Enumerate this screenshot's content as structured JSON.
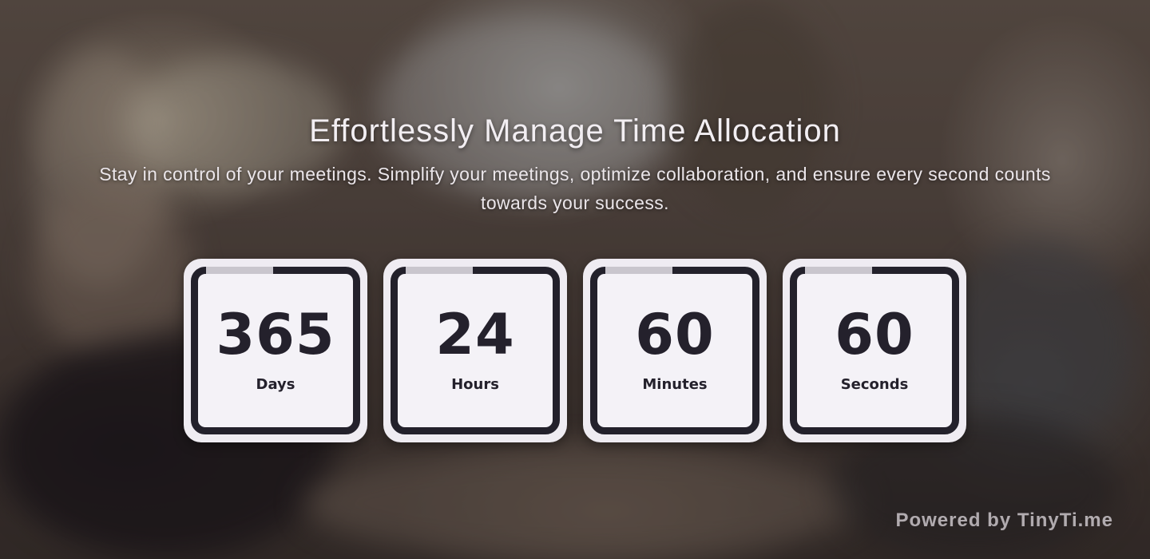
{
  "hero": {
    "title": "Effortlessly Manage Time Allocation",
    "subtitle": "Stay in control of your meetings. Simplify your meetings, optimize collaboration, and ensure every second counts towards your success."
  },
  "counters": [
    {
      "value": "365",
      "label": "Days"
    },
    {
      "value": "24",
      "label": "Hours"
    },
    {
      "value": "60",
      "label": "Minutes"
    },
    {
      "value": "60",
      "label": "Seconds"
    }
  ],
  "footer": {
    "powered_by": "Powered by TinyTi.me"
  },
  "colors": {
    "card_background": "#efecf2",
    "card_frame": "#23212b",
    "text_light": "#f2eef2"
  }
}
